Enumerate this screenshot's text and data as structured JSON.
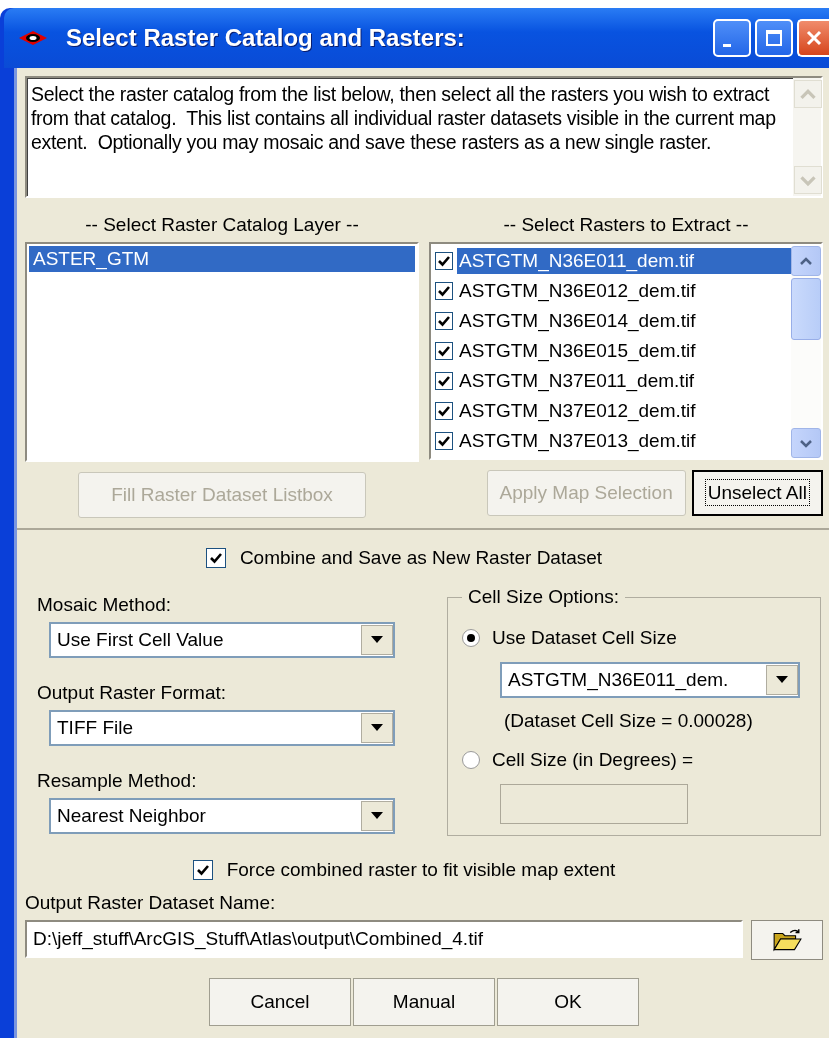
{
  "window": {
    "title": "Select Raster Catalog and Rasters:"
  },
  "description": "Select the raster catalog from the list below, then select all the rasters you wish to extract from that catalog.  This list contains all individual raster datasets visible in the current map extent.  Optionally you may mosaic and save these rasters as a new single raster.",
  "catalog": {
    "heading": "-- Select Raster Catalog Layer --",
    "items": [
      {
        "label": "ASTER_GTM",
        "selected": true
      }
    ],
    "button": {
      "label": "Fill Raster Dataset Listbox",
      "disabled": true
    }
  },
  "rasters": {
    "heading": "-- Select Rasters to Extract --",
    "items": [
      {
        "label": "ASTGTM_N36E011_dem.tif",
        "checked": true,
        "selected": true
      },
      {
        "label": "ASTGTM_N36E012_dem.tif",
        "checked": true,
        "selected": false
      },
      {
        "label": "ASTGTM_N36E014_dem.tif",
        "checked": true,
        "selected": false
      },
      {
        "label": "ASTGTM_N36E015_dem.tif",
        "checked": true,
        "selected": false
      },
      {
        "label": "ASTGTM_N37E011_dem.tif",
        "checked": true,
        "selected": false
      },
      {
        "label": "ASTGTM_N37E012_dem.tif",
        "checked": true,
        "selected": false
      },
      {
        "label": "ASTGTM_N37E013_dem.tif",
        "checked": true,
        "selected": false
      }
    ],
    "buttons": [
      {
        "label": "Apply Map Selection",
        "disabled": true,
        "focused": false
      },
      {
        "label": "Unselect All",
        "disabled": false,
        "focused": true
      }
    ]
  },
  "combine": {
    "label": "Combine and Save as New Raster Dataset",
    "checked": true
  },
  "dropdowns": [
    {
      "label": "Mosaic Method:",
      "value": "Use First Cell Value"
    },
    {
      "label": "Output Raster Format:",
      "value": "TIFF File"
    },
    {
      "label": "Resample Method:",
      "value": "Nearest Neighbor"
    }
  ],
  "cell_size_options": {
    "title": "Cell Size Options:",
    "dataset_option": {
      "label": "Use Dataset Cell Size",
      "selected": true
    },
    "dataset_combo": "ASTGTM_N36E011_dem.",
    "dataset_info": "(Dataset Cell Size = 0.00028)",
    "degrees_option": {
      "label": "Cell Size (in Degrees) =",
      "selected": false
    }
  },
  "force_extent": {
    "label": "Force combined raster to fit visible map extent",
    "checked": true
  },
  "output_name": {
    "label": "Output Raster Dataset Name:",
    "value": "D:\\jeff_stuff\\ArcGIS_Stuff\\Atlas\\output\\Combined_4.tif"
  },
  "buttons": [
    "Cancel",
    "Manual",
    "OK"
  ]
}
